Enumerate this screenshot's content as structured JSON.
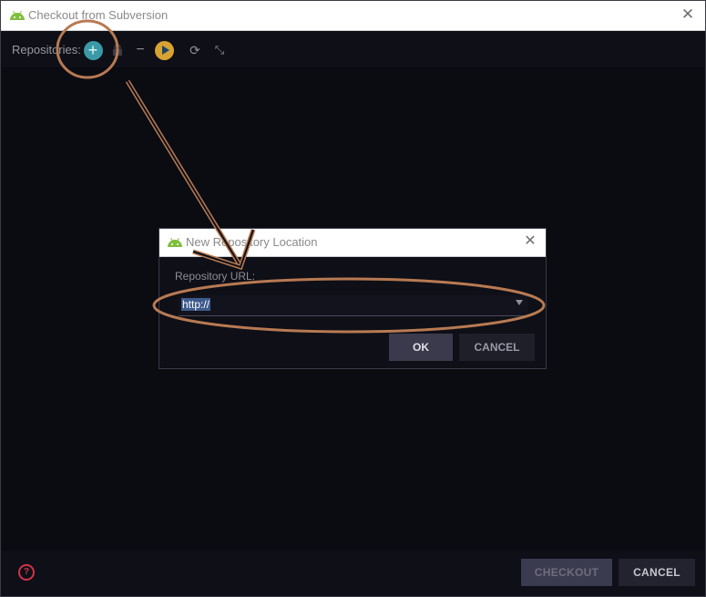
{
  "window": {
    "title": "Checkout from Subversion",
    "close_label": "✕"
  },
  "toolbar": {
    "repositories_label": "Repositories:",
    "add_icon": "+",
    "minus_icon": "−",
    "refresh_icon": "⟳",
    "collapse_icon": "⤡"
  },
  "footer": {
    "help_icon": "?",
    "checkout_label": "CHECKOUT",
    "cancel_label": "CANCEL"
  },
  "dialog": {
    "title": "New Repository Location",
    "close_label": "✕",
    "url_label": "Repository URL:",
    "url_value": "http://",
    "ok_label": "OK",
    "cancel_label": "CANCEL"
  },
  "annotation": {
    "color": "#b87a52"
  }
}
